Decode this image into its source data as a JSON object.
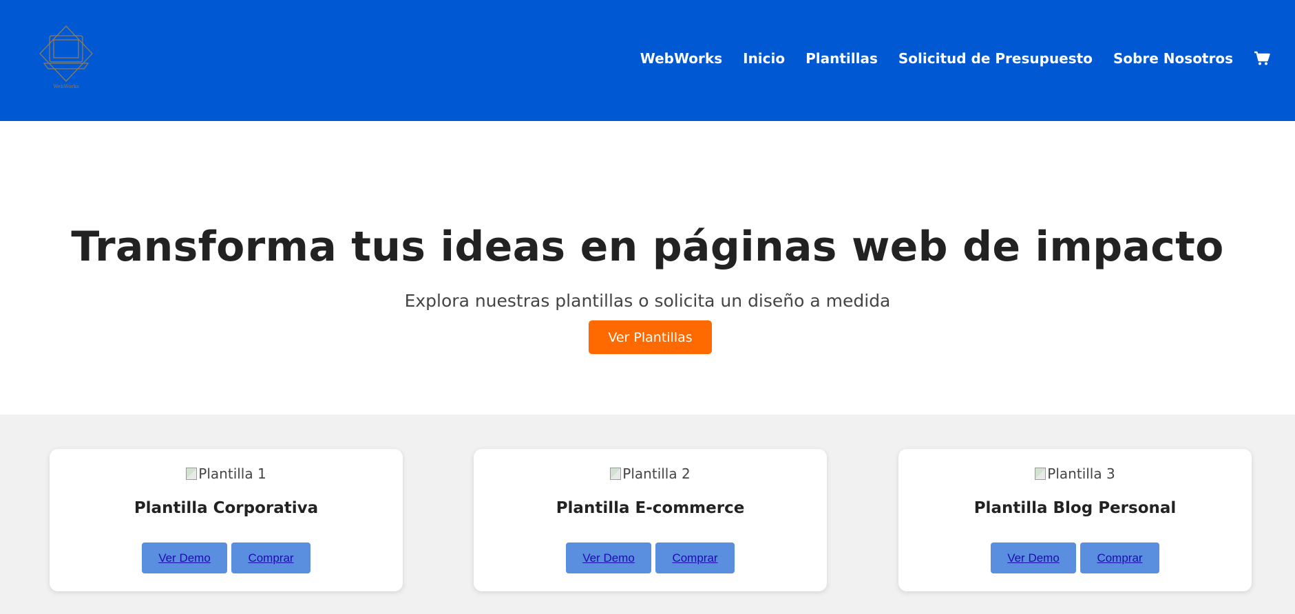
{
  "header": {
    "logo_text": "WebWorks",
    "nav": [
      "WebWorks",
      "Inicio",
      "Plantillas",
      "Solicitud de Presupuesto",
      "Sobre Nosotros"
    ],
    "cart_icon": "cart-icon",
    "colors": {
      "background": "#0058D2",
      "text": "#FFFFFF"
    }
  },
  "hero": {
    "title": "Transforma tus ideas en páginas web de impacto",
    "subtitle": "Explora nuestras plantillas o solicita un diseño a medida",
    "cta": "Ver Plantillas",
    "cta_color": "#FF6A00"
  },
  "templates": [
    {
      "image_alt": "Plantilla 1",
      "name": "Plantilla Corporativa",
      "demo": "Ver Demo",
      "buy": "Comprar"
    },
    {
      "image_alt": "Plantilla 2",
      "name": "Plantilla E-commerce",
      "demo": "Ver Demo",
      "buy": "Comprar"
    },
    {
      "image_alt": "Plantilla 3",
      "name": "Plantilla Blog Personal",
      "demo": "Ver Demo",
      "buy": "Comprar"
    }
  ],
  "colors": {
    "button": "#5A8FE0",
    "link_text": "#1A0DAB",
    "section_bg": "#F1F1F1"
  }
}
